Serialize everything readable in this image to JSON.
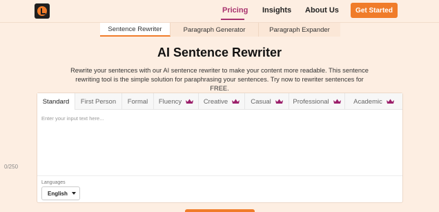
{
  "header": {
    "logo_icon": "app-logo",
    "nav": [
      {
        "label": "Pricing",
        "active": true
      },
      {
        "label": "Insights"
      },
      {
        "label": "About Us"
      }
    ],
    "cta_label": "Get Started",
    "accent": "#f07c2a",
    "active_color": "#a8326e"
  },
  "tool_tabs": [
    {
      "label": "Sentence Rewriter",
      "active": true
    },
    {
      "label": "Paragraph Generator"
    },
    {
      "label": "Paragraph Expander"
    }
  ],
  "page": {
    "title": "AI Sentence Rewriter",
    "description_line1": "Rewrite your sentences with our AI sentence rewriter to make your content more readable. This sentence",
    "description_line2": "rewriting tool is the simple solution for paraphrasing your sentences. Try now to rewriter sentences for FREE."
  },
  "editor": {
    "modes": [
      {
        "label": "Standard",
        "premium": false,
        "active": true
      },
      {
        "label": "First Person",
        "premium": false
      },
      {
        "label": "Formal",
        "premium": false
      },
      {
        "label": "Fluency",
        "premium": true
      },
      {
        "label": "Creative",
        "premium": true
      },
      {
        "label": "Casual",
        "premium": true
      },
      {
        "label": "Professional",
        "premium": true
      },
      {
        "label": "Academic",
        "premium": true
      }
    ],
    "premium_icon": "crown-icon",
    "premium_color": "#9b1f6a",
    "input_placeholder": "Enter your input text here...",
    "char_count": "0/250",
    "languages_label": "Languages",
    "language_value": "English"
  }
}
